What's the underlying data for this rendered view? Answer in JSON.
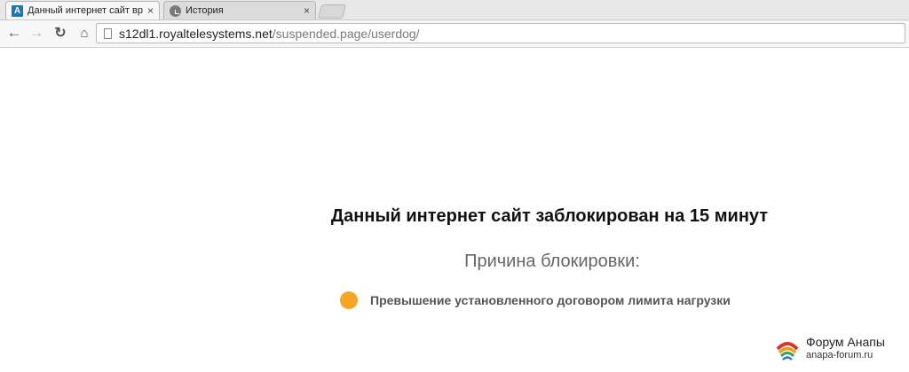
{
  "browser": {
    "tabs": [
      {
        "title": "Данный интернет сайт вр",
        "favicon": "A",
        "active": true
      },
      {
        "title": "История",
        "favicon": "history-icon",
        "active": false
      }
    ],
    "close_glyph": "×",
    "address": {
      "host": "s12dl1.royaltelesystems.net",
      "path": "/suspended.page/userdog/"
    }
  },
  "page": {
    "headline": "Данный интернет сайт заблокирован на 15 минут",
    "reason_label": "Причина блокировки:",
    "reason_text": "Превышение установленного договором лимита нагрузки",
    "colors": {
      "reason_dot": "#f5a623"
    }
  },
  "watermark": {
    "title": "Форум Анапы",
    "subtitle": "anapa-forum.ru"
  }
}
